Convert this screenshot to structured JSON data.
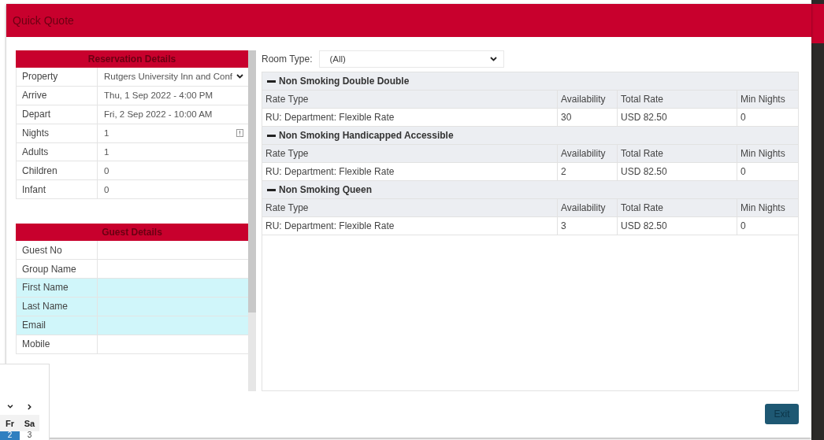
{
  "window": {
    "title": "Quick Quote"
  },
  "reservation_details": {
    "title": "Reservation Details",
    "rows": [
      {
        "label": "Property",
        "value": "Rutgers University Inn and Conf",
        "kind": "select"
      },
      {
        "label": "Arrive",
        "value": "Thu, 1 Sep 2022 - 4:00 PM",
        "kind": "text"
      },
      {
        "label": "Depart",
        "value": "Fri, 2 Sep 2022 - 10:00 AM",
        "kind": "text"
      },
      {
        "label": "Nights",
        "value": "1",
        "kind": "number"
      },
      {
        "label": "Adults",
        "value": "1",
        "kind": "text"
      },
      {
        "label": "Children",
        "value": "0",
        "kind": "text"
      },
      {
        "label": "Infant",
        "value": "0",
        "kind": "text"
      }
    ]
  },
  "guest_details": {
    "title": "Guest Details",
    "rows": [
      {
        "label": "Guest No",
        "required": false
      },
      {
        "label": "Group Name",
        "required": false
      },
      {
        "label": "First Name",
        "required": true
      },
      {
        "label": "Last Name",
        "required": true
      },
      {
        "label": "Email",
        "required": true
      },
      {
        "label": "Mobile",
        "required": false
      }
    ]
  },
  "room_type": {
    "label": "Room Type:",
    "value": "(All)"
  },
  "rooms": [
    {
      "name": "Non Smoking Double Double",
      "expanded": true,
      "columns": [
        "Rate Type",
        "Availability",
        "Total Rate",
        "Min Nights"
      ],
      "rates": [
        {
          "rate_type": "RU: Department: Flexible Rate",
          "availability": "30",
          "total_rate": "USD 82.50",
          "min_nights": "0"
        }
      ]
    },
    {
      "name": "Non Smoking Handicapped Accessible",
      "expanded": true,
      "columns": [
        "Rate Type",
        "Availability",
        "Total Rate",
        "Min Nights"
      ],
      "rates": [
        {
          "rate_type": "RU: Department: Flexible Rate",
          "availability": "2",
          "total_rate": "USD 82.50",
          "min_nights": "0"
        }
      ]
    },
    {
      "name": "Non Smoking Queen",
      "expanded": true,
      "columns": [
        "Rate Type",
        "Availability",
        "Total Rate",
        "Min Nights"
      ],
      "rates": [
        {
          "rate_type": "RU: Department: Flexible Rate",
          "availability": "3",
          "total_rate": "USD 82.50",
          "min_nights": "0"
        }
      ]
    }
  ],
  "exit_button": {
    "label": "Exit"
  },
  "calendar_popup": {
    "weekdays": [
      "Fr",
      "Sa"
    ],
    "days": [
      {
        "label": "2",
        "selected": true
      },
      {
        "label": "3",
        "selected": false
      }
    ]
  }
}
